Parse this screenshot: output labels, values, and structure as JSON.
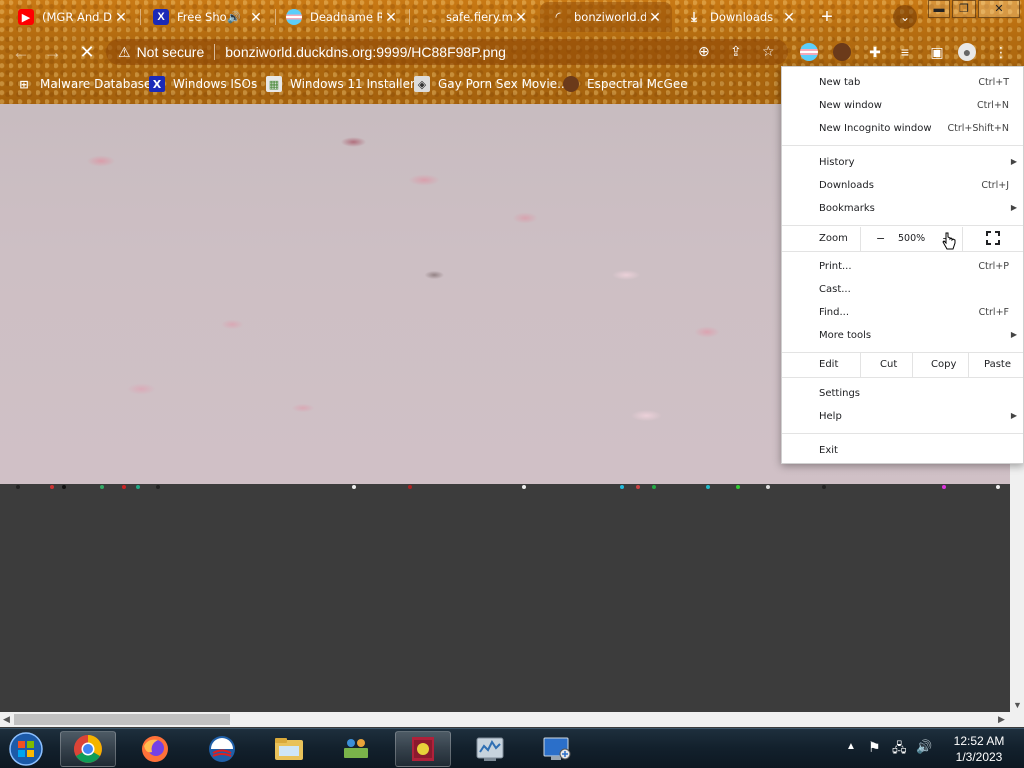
{
  "tabs": [
    {
      "title": "(MGR And D...",
      "favicon": "youtube-icon",
      "color": "#ff0000",
      "has_audio": false
    },
    {
      "title": "Free Sho",
      "favicon": "x-icon",
      "color": "#1b2ab8",
      "has_audio": true
    },
    {
      "title": "Deadname Re",
      "favicon": "trans-flag-icon",
      "color": "#5bcefa",
      "has_audio": false
    },
    {
      "title": "safe.fiery.me",
      "favicon": "blank-page-icon",
      "color": "#b46c10",
      "has_audio": false
    },
    {
      "title": "bonziworld.d",
      "favicon": "loading-spinner-icon",
      "color": "#ffffff",
      "has_audio": false,
      "active": true
    },
    {
      "title": "Downloads",
      "favicon": "download-icon",
      "color": "#ffffff",
      "has_audio": false
    }
  ],
  "toolbar": {
    "security_label": "Not secure",
    "url": "bonziworld.duckdns.org:9999/HC88F98P.png"
  },
  "bookmarks": [
    {
      "label": "Malware Database",
      "favicon": "windows-logo-icon"
    },
    {
      "label": "Windows ISOs",
      "favicon": "x-icon"
    },
    {
      "label": "Windows 11 Installer",
      "favicon": "image-icon"
    },
    {
      "label": "Gay Porn Sex Movie...",
      "favicon": "cube-icon"
    },
    {
      "label": "Espectral McGee",
      "favicon": "avatar-icon"
    }
  ],
  "menu": {
    "new_tab": {
      "label": "New tab",
      "shortcut": "Ctrl+T"
    },
    "new_window": {
      "label": "New window",
      "shortcut": "Ctrl+N"
    },
    "new_incognito": {
      "label": "New Incognito window",
      "shortcut": "Ctrl+Shift+N"
    },
    "history": {
      "label": "History"
    },
    "downloads": {
      "label": "Downloads",
      "shortcut": "Ctrl+J"
    },
    "bookmarks": {
      "label": "Bookmarks"
    },
    "zoom": {
      "label": "Zoom",
      "minus": "−",
      "value": "500%",
      "plus": "+"
    },
    "print": {
      "label": "Print...",
      "shortcut": "Ctrl+P"
    },
    "cast": {
      "label": "Cast..."
    },
    "find": {
      "label": "Find...",
      "shortcut": "Ctrl+F"
    },
    "more_tools": {
      "label": "More tools"
    },
    "edit": {
      "label": "Edit",
      "cut": "Cut",
      "copy": "Copy",
      "paste": "Paste"
    },
    "settings": {
      "label": "Settings"
    },
    "help": {
      "label": "Help"
    },
    "exit": {
      "label": "Exit"
    }
  },
  "taskbar": {
    "apps": [
      "chrome-icon",
      "firefox-icon",
      "obama-logo-icon",
      "file-explorer-icon",
      "network-people-icon",
      "winrar-icon",
      "task-manager-icon",
      "remote-desktop-icon"
    ],
    "time": "12:52 AM",
    "date": "1/3/2023"
  },
  "colors": {
    "theme": "#b46c10",
    "menu_bg": "#ffffff",
    "taskbar": "#12202c"
  }
}
